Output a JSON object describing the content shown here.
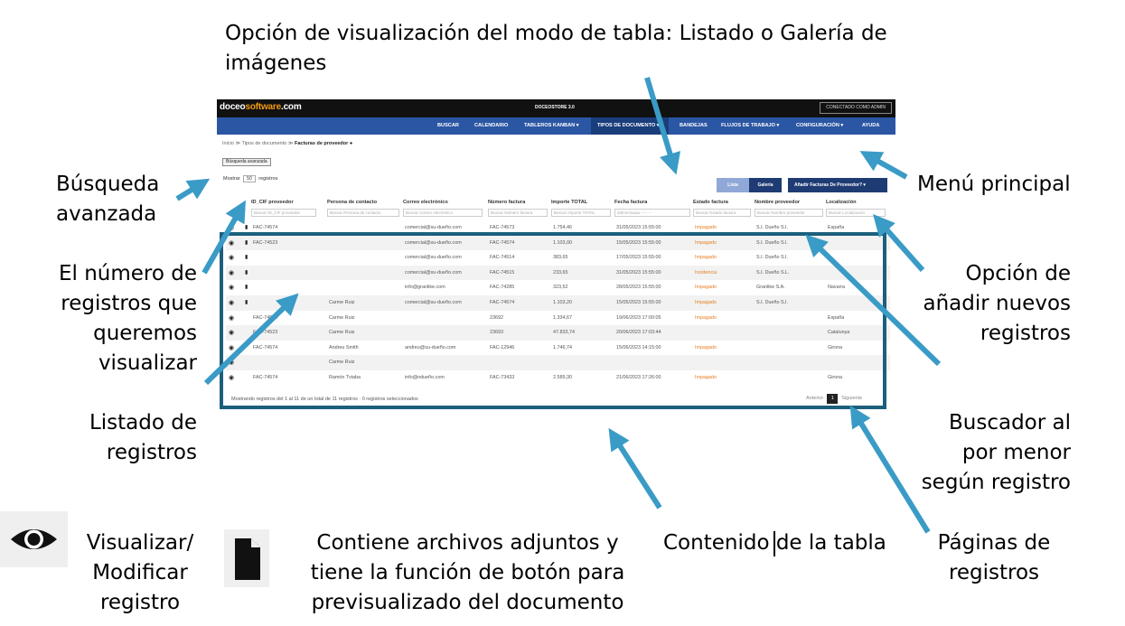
{
  "annotations": {
    "top": "Opción de visualización del modo de tabla: Listado o Galería de imágenes",
    "busqueda": "Búsqueda avanzada",
    "menu": "Menú principal",
    "numero": "El número de registros que queremos visualizar",
    "anadir": "Opción de añadir nuevos registros",
    "listado": "Listado de registros",
    "buscador": "Buscador al por menor según registro",
    "visualizar": "Visualizar/ Modificar registro",
    "adjuntos": "Contiene archivos adjuntos y tiene la función de botón para previsualizado del documento",
    "contenido": "Contenido de la tabla",
    "paginas": "Páginas de registros"
  },
  "app": {
    "logo_a": "doceo",
    "logo_b": "software",
    "logo_c": ".com",
    "title": "DOCEOSTORE 3.0",
    "login": "CONECTADO COMO ADMIN",
    "nav": [
      "BUSCAR",
      "CALENDARIO",
      "TABLEROS KANBAN ▾",
      "TIPOS DE DOCUMENTO ▾",
      "BANDEJAS",
      "FLUJOS DE TRABAJO ▾",
      "CONFIGURACIÓN ▾",
      "AYUDA"
    ],
    "breadcrumb": "Inicio  ≫  Tipos de documento  ≫ ",
    "breadcrumb_current": "Facturas de proveedor",
    "advanced_search": "Búsqueda avanzada",
    "show_label": "Mostrar",
    "show_value": "50",
    "show_suffix": "registros",
    "btn_lista": "Lista",
    "btn_galeria": "Galería",
    "btn_add": "Añadir Facturas De Proveedor?   ▾",
    "columns": [
      "ID_CIF proveedor",
      "Persona de contacto",
      "Correo electrónico",
      "Número factura",
      "Importe TOTAL",
      "Fecha factura",
      "Estado factura",
      "Nombre proveedor",
      "Localización"
    ],
    "filters": [
      "Buscar ID_CIF proveedor",
      "Buscar Persona de contacto",
      "Buscar Correo electrónico",
      "Buscar Número factura",
      "Buscar Importe TOTAL",
      "dd/mm/aaaa --:-- --",
      "Buscar Estado factura",
      "Buscar Nombre proveedor",
      "Buscar Localización"
    ],
    "rows": [
      [
        "FAC-74574",
        "",
        "comercial@su-dueño.com",
        "FAC-74573",
        "1.754,46",
        "31/05/2023 15:55:00",
        "Impagado",
        "S.I. Dueño S.I.",
        "España"
      ],
      [
        "FAC-74523",
        "",
        "comercial@su-dueño.com",
        "FAC-74574",
        "1.103,00",
        "15/05/2023 15:55:00",
        "Impagado",
        "S.I. Dueño S.I.",
        ""
      ],
      [
        "",
        "",
        "comercial@su-dueño.com",
        "FAC-74514",
        "383,65",
        "17/05/2023 15:55:00",
        "Impagado",
        "S.I. Dueño S.I.",
        ""
      ],
      [
        "",
        "",
        "comercial@su-dueño.com",
        "FAC-74515",
        "233,65",
        "31/05/2023 15:55:00",
        "Incidencia",
        "S.I. Dueño S.L.",
        ""
      ],
      [
        "",
        "",
        "info@granlike.com",
        "FAC-74285",
        "323,52",
        "28/05/2023 15:55:00",
        "Impagado",
        "Granlike S.A.",
        "Navarra"
      ],
      [
        "",
        "Carme Ruiz",
        "comercial@su-dueño.com",
        "FAC-74574",
        "1.103,20",
        "15/05/2023 15:55:00",
        "Impagado",
        "S.I. Dueño S.I.",
        ""
      ],
      [
        "FAC-74574",
        "Carme Ruiz",
        "",
        "23692",
        "1.334,67",
        "19/06/2023 17:00:05",
        "Impagado",
        "",
        "España"
      ],
      [
        "FAC-74523",
        "Carme Ruiz",
        "",
        "23693",
        "47.833,74",
        "20/06/2023 17:03:44",
        "",
        "",
        "Catalunya"
      ],
      [
        "FAC-74574",
        "Andreu Smith",
        "andreu@su-dueño.com",
        "FAC-12946",
        "1.746,74",
        "15/06/2023 14:15:00",
        "Impagado",
        "",
        "Girona"
      ],
      [
        "",
        "Carme Ruiz",
        "",
        "",
        "",
        "",
        "",
        "",
        ""
      ],
      [
        "FAC-74574",
        "Ramón Tviaba",
        "info@ndueño.com",
        "FAC-73433",
        "2.589,30",
        "21/06/2023 17:26:00",
        "Impagado",
        "",
        "Girona"
      ]
    ],
    "footer": "Mostrando registros del 1 al 11 de un total de 11 registros · 0 registros seleccionados",
    "prev": "Anterior",
    "page": "1",
    "next": "Siguiente"
  },
  "colors": {
    "topbar": "#111111",
    "nav": "#2b56a3",
    "arrow": "#3a9bc6",
    "frame": "#1c5f7c"
  }
}
